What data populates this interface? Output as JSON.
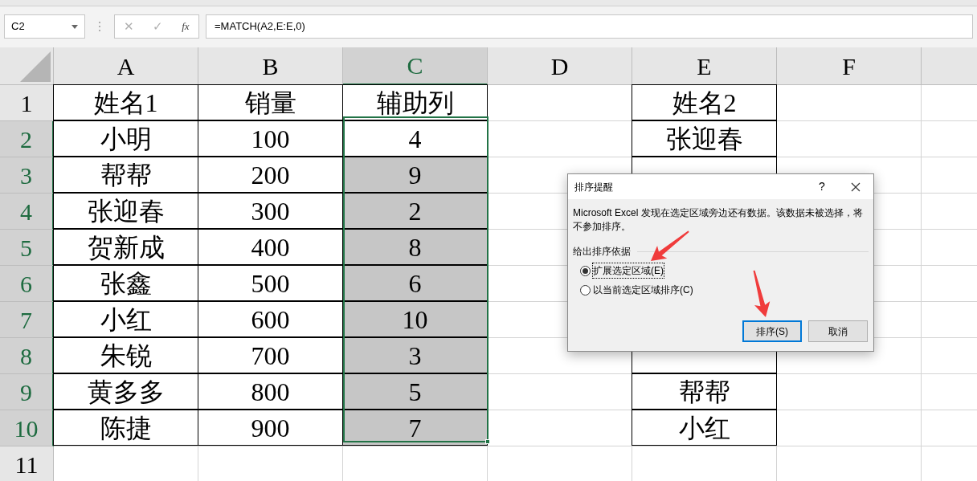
{
  "name_box": "C2",
  "formula_bar": {
    "cancel": "✕",
    "enter": "✓",
    "function": "fx",
    "formula": "=MATCH(A2,E:E,0)"
  },
  "columns": [
    {
      "label": "A",
      "selected": false
    },
    {
      "label": "B",
      "selected": false
    },
    {
      "label": "C",
      "selected": true
    },
    {
      "label": "D",
      "selected": false
    },
    {
      "label": "E",
      "selected": false
    },
    {
      "label": "F",
      "selected": false
    }
  ],
  "rows": [
    {
      "label": "1",
      "selected": false,
      "cells": [
        {
          "kind": "data",
          "text": "姓名1"
        },
        {
          "kind": "data",
          "text": "销量"
        },
        {
          "kind": "data",
          "text": "辅助列",
          "selected": false
        },
        {
          "kind": "empty"
        },
        {
          "kind": "data",
          "text": "姓名2"
        },
        {
          "kind": "empty"
        }
      ]
    },
    {
      "label": "2",
      "selected": true,
      "cells": [
        {
          "kind": "data",
          "text": "小明"
        },
        {
          "kind": "data",
          "text": "100"
        },
        {
          "kind": "data",
          "text": "4",
          "selected": false
        },
        {
          "kind": "empty"
        },
        {
          "kind": "data",
          "text": "张迎春"
        },
        {
          "kind": "empty"
        }
      ]
    },
    {
      "label": "3",
      "selected": true,
      "cells": [
        {
          "kind": "data",
          "text": "帮帮"
        },
        {
          "kind": "data",
          "text": "200"
        },
        {
          "kind": "data",
          "text": "9",
          "selected": true
        },
        {
          "kind": "empty"
        },
        {
          "kind": "data"
        },
        {
          "kind": "empty"
        }
      ]
    },
    {
      "label": "4",
      "selected": true,
      "cells": [
        {
          "kind": "data",
          "text": "张迎春"
        },
        {
          "kind": "data",
          "text": "300"
        },
        {
          "kind": "data",
          "text": "2",
          "selected": true
        },
        {
          "kind": "empty"
        },
        {
          "kind": "empty"
        },
        {
          "kind": "empty"
        }
      ]
    },
    {
      "label": "5",
      "selected": true,
      "cells": [
        {
          "kind": "data",
          "text": "贺新成"
        },
        {
          "kind": "data",
          "text": "400"
        },
        {
          "kind": "data",
          "text": "8",
          "selected": true
        },
        {
          "kind": "empty"
        },
        {
          "kind": "empty"
        },
        {
          "kind": "empty"
        }
      ]
    },
    {
      "label": "6",
      "selected": true,
      "cells": [
        {
          "kind": "data",
          "text": "张鑫"
        },
        {
          "kind": "data",
          "text": "500"
        },
        {
          "kind": "data",
          "text": "6",
          "selected": true
        },
        {
          "kind": "empty"
        },
        {
          "kind": "empty"
        },
        {
          "kind": "empty"
        }
      ]
    },
    {
      "label": "7",
      "selected": true,
      "cells": [
        {
          "kind": "data",
          "text": "小红"
        },
        {
          "kind": "data",
          "text": "600"
        },
        {
          "kind": "data",
          "text": "10",
          "selected": true
        },
        {
          "kind": "empty"
        },
        {
          "kind": "empty"
        },
        {
          "kind": "empty"
        }
      ]
    },
    {
      "label": "8",
      "selected": true,
      "cells": [
        {
          "kind": "data",
          "text": "朱锐"
        },
        {
          "kind": "data",
          "text": "700"
        },
        {
          "kind": "data",
          "text": "3",
          "selected": true
        },
        {
          "kind": "empty"
        },
        {
          "kind": "data"
        },
        {
          "kind": "empty"
        }
      ]
    },
    {
      "label": "9",
      "selected": true,
      "cells": [
        {
          "kind": "data",
          "text": "黄多多"
        },
        {
          "kind": "data",
          "text": "800"
        },
        {
          "kind": "data",
          "text": "5",
          "selected": true
        },
        {
          "kind": "empty"
        },
        {
          "kind": "data",
          "text": "帮帮"
        },
        {
          "kind": "empty"
        }
      ]
    },
    {
      "label": "10",
      "selected": true,
      "cells": [
        {
          "kind": "data",
          "text": "陈捷"
        },
        {
          "kind": "data",
          "text": "900"
        },
        {
          "kind": "data",
          "text": "7",
          "selected": true
        },
        {
          "kind": "empty"
        },
        {
          "kind": "data",
          "text": "小红"
        },
        {
          "kind": "empty"
        }
      ]
    },
    {
      "label": "11",
      "selected": false,
      "cells": [
        {
          "kind": "empty"
        },
        {
          "kind": "empty"
        },
        {
          "kind": "empty"
        },
        {
          "kind": "empty"
        },
        {
          "kind": "empty"
        },
        {
          "kind": "empty"
        }
      ]
    }
  ],
  "dialog": {
    "title": "排序提醒",
    "help": "?",
    "message": "Microsoft Excel 发现在选定区域旁边还有数据。该数据未被选择，将不参加排序。",
    "group_label": "给出排序依据",
    "options": [
      {
        "label": "扩展选定区域(E)",
        "selected": true
      },
      {
        "label": "以当前选定区域排序(C)",
        "selected": false
      }
    ],
    "buttons": [
      {
        "label": "排序(S)",
        "default": true
      },
      {
        "label": "取消",
        "default": false
      }
    ]
  }
}
